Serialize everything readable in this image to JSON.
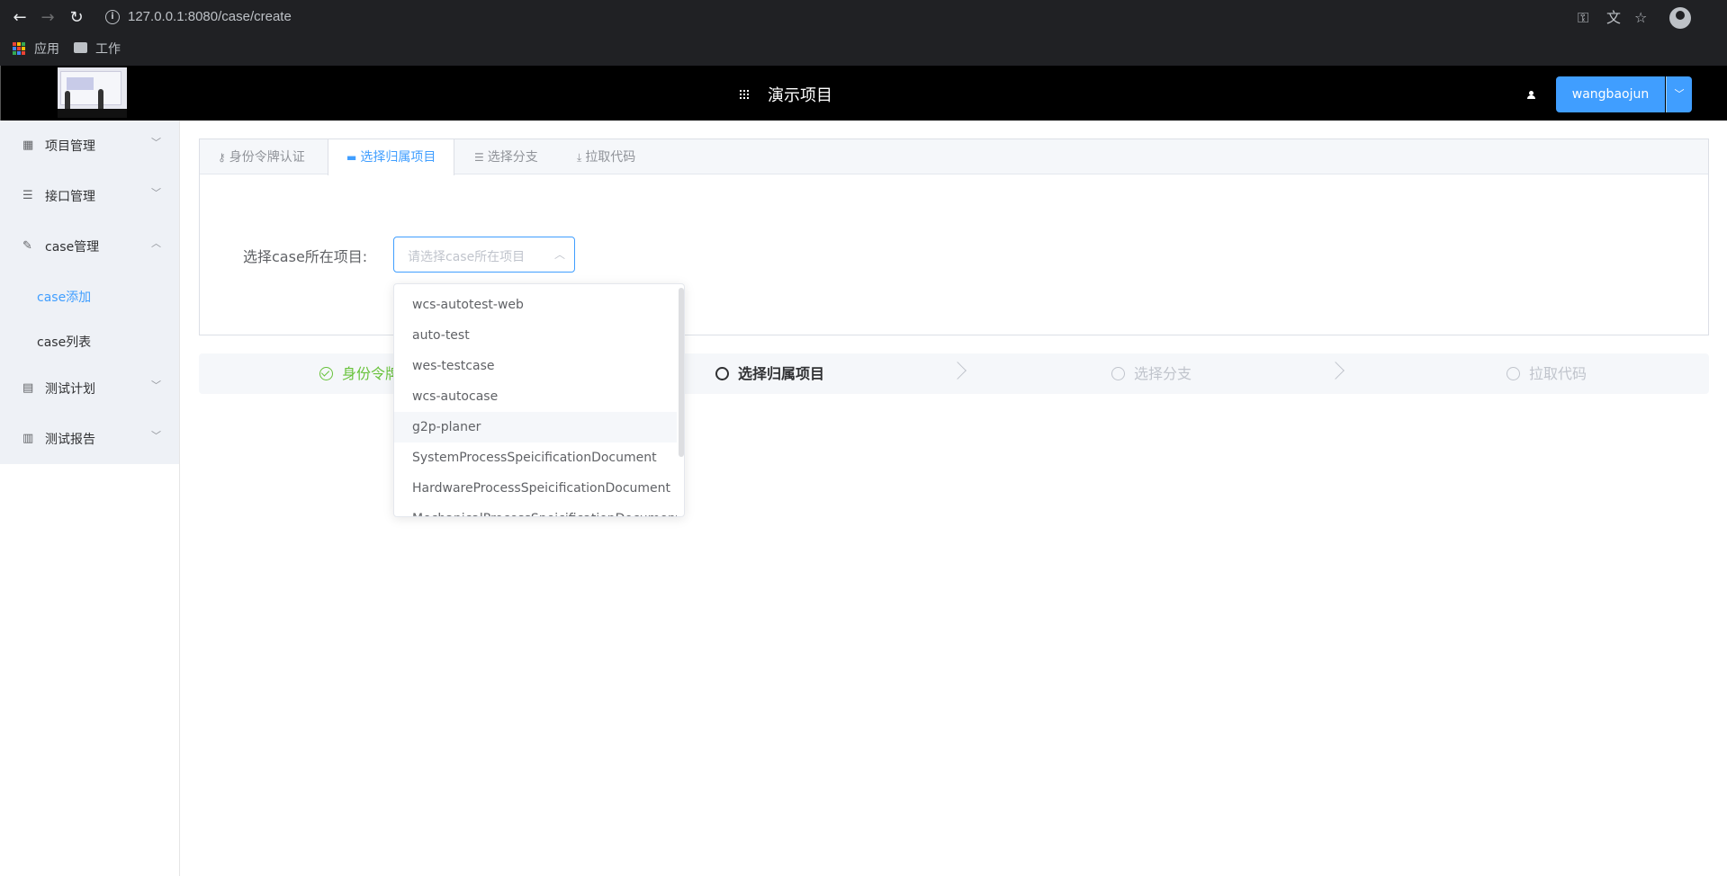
{
  "browser": {
    "url": "127.0.0.1:8080/case/create",
    "bookmarks": [
      {
        "label": "应用"
      },
      {
        "label": "工作"
      }
    ]
  },
  "header": {
    "project_title": "演示项目",
    "user_name": "wangbaojun"
  },
  "sidebar": {
    "items": [
      {
        "label": "项目管理",
        "icon": "grid-icon"
      },
      {
        "label": "接口管理",
        "icon": "list-icon"
      },
      {
        "label": "case管理",
        "icon": "edit-icon"
      },
      {
        "label": "测试计划",
        "icon": "document-icon"
      },
      {
        "label": "测试报告",
        "icon": "bar-chart-icon"
      }
    ],
    "sub_items": [
      {
        "label": "case添加",
        "active": true
      },
      {
        "label": "case列表",
        "active": false
      }
    ]
  },
  "tabs": [
    {
      "label": "身份令牌认证",
      "icon": "key-icon"
    },
    {
      "label": "选择归属项目",
      "icon": "monitor-icon",
      "active": true
    },
    {
      "label": "选择分支",
      "icon": "sliders-icon"
    },
    {
      "label": "拉取代码",
      "icon": "download-icon"
    }
  ],
  "form": {
    "label": "选择case所在项目:",
    "placeholder": "请选择case所在项目"
  },
  "dropdown": {
    "options": [
      "wcs-autotest-web",
      "auto-test",
      "wes-testcase",
      "wcs-autocase",
      "g2p-planer",
      "SystemProcessSpeicificationDocument",
      "HardwareProcessSpeicificationDocument",
      "MechanicalProcessSpeicificationDocument"
    ],
    "hovered_index": 4
  },
  "steps": [
    {
      "label": "身份令牌认证",
      "status": "done"
    },
    {
      "label": "选择归属项目",
      "status": "process"
    },
    {
      "label": "选择分支",
      "status": "wait"
    },
    {
      "label": "拉取代码",
      "status": "wait"
    }
  ],
  "colors": {
    "primary": "#409eff",
    "success": "#67c23a",
    "header_bg": "#000000",
    "sidebar_bg": "#eef1f6"
  }
}
